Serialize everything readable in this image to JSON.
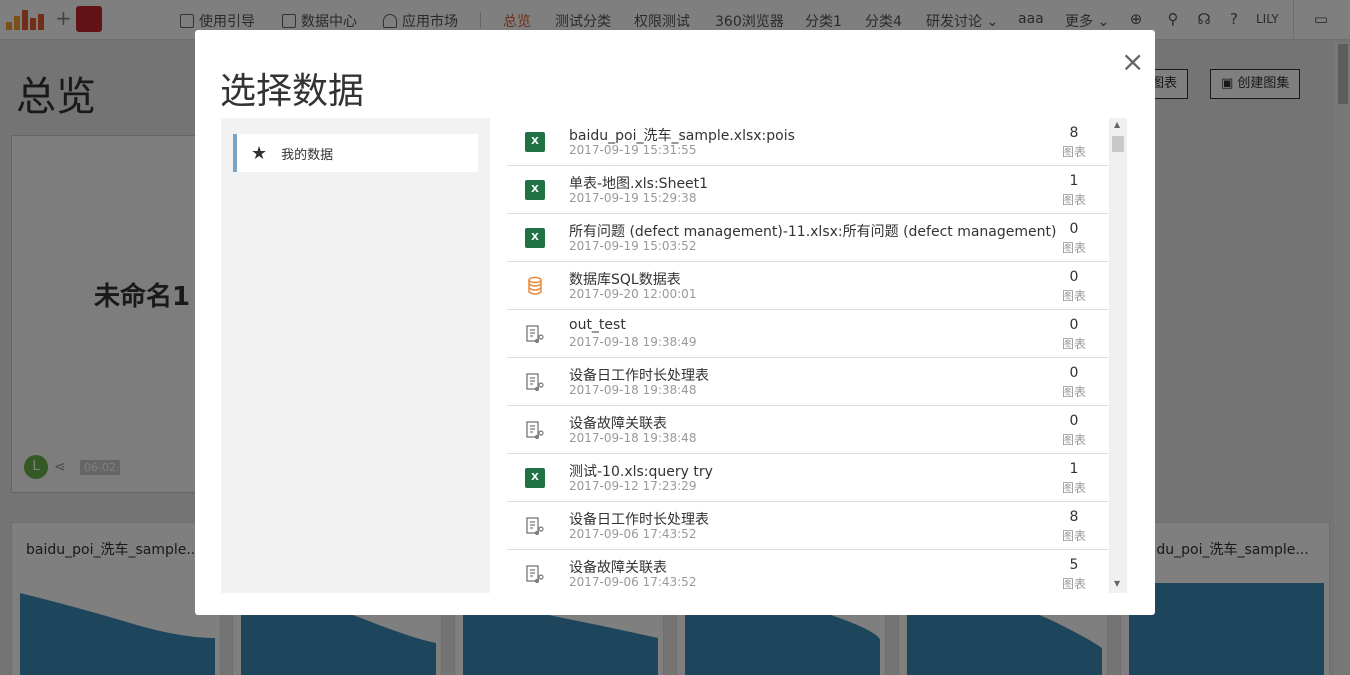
{
  "topbar": {
    "nav_left": [
      {
        "label": "使用引导",
        "icon": "guide-icon"
      },
      {
        "label": "数据中心",
        "icon": "document-icon"
      },
      {
        "label": "应用市场",
        "icon": "market-icon"
      }
    ],
    "nav_right": [
      {
        "label": "总览",
        "active": true
      },
      {
        "label": "测试分类"
      },
      {
        "label": "权限测试"
      },
      {
        "label": "360浏览器"
      },
      {
        "label": "分类1"
      },
      {
        "label": "分类4"
      },
      {
        "label": "研发讨论 ⌄"
      },
      {
        "label": "aaa"
      },
      {
        "label": "更多 ⌄"
      }
    ],
    "user": "LILY",
    "accent": "#e05c2f",
    "brand_color": "#c7252b"
  },
  "background": {
    "page_title": "总览",
    "create_chart_label": "图表",
    "create_gallery_label": "创建图集",
    "card_title": "未命名1",
    "avatar_letter": "L",
    "card_date": "06-02",
    "mini_title_left": "baidu_poi_洗车_sample...",
    "mini_title_right": "baidu_poi_洗车_sample...",
    "chart_color": "#3a8bb7"
  },
  "modal": {
    "title": "选择数据",
    "close": "×",
    "side_item": "我的数据",
    "count_label": "图表",
    "rows": [
      {
        "icon": "excel",
        "name": "baidu_poi_洗车_sample.xlsx:pois",
        "date": "2017-09-19 15:31:55",
        "count": "8"
      },
      {
        "icon": "excel",
        "name": "单表-地图.xls:Sheet1",
        "date": "2017-09-19 15:29:38",
        "count": "1"
      },
      {
        "icon": "excel",
        "name": "所有问题 (defect management)-11.xlsx:所有问题 (defect management)",
        "date": "2017-09-19 15:03:52",
        "count": "0"
      },
      {
        "icon": "database",
        "name": "数据库SQL数据表",
        "date": "2017-09-20 12:00:01",
        "count": "0"
      },
      {
        "icon": "dataset",
        "name": "out_test",
        "date": "2017-09-18 19:38:49",
        "count": "0"
      },
      {
        "icon": "dataset",
        "name": "设备日工作时长处理表",
        "date": "2017-09-18 19:38:48",
        "count": "0"
      },
      {
        "icon": "dataset",
        "name": "设备故障关联表",
        "date": "2017-09-18 19:38:48",
        "count": "0"
      },
      {
        "icon": "excel",
        "name": "测试-10.xls:query try",
        "date": "2017-09-12 17:23:29",
        "count": "1"
      },
      {
        "icon": "dataset",
        "name": "设备日工作时长处理表",
        "date": "2017-09-06 17:43:52",
        "count": "8"
      },
      {
        "icon": "dataset",
        "name": "设备故障关联表",
        "date": "2017-09-06 17:43:52",
        "count": "5"
      }
    ]
  }
}
